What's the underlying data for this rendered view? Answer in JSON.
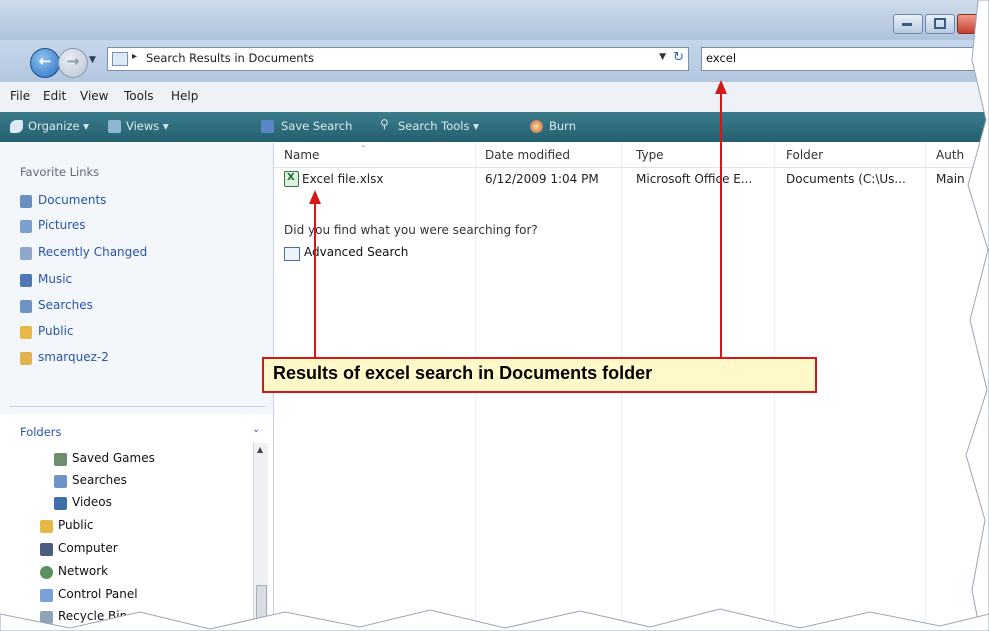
{
  "address_bar": {
    "path": "Search Results in Documents",
    "search_value": "excel"
  },
  "menu": [
    "File",
    "Edit",
    "View",
    "Tools",
    "Help"
  ],
  "toolbar": {
    "organize": "Organize ▾",
    "views": "Views ▾",
    "save_search": "Save Search",
    "search_tools": "Search Tools ▾",
    "burn": "Burn"
  },
  "nav_pane": {
    "favorite_links_title": "Favorite Links",
    "favorite_links": [
      "Documents",
      "Pictures",
      "Recently Changed",
      "Music",
      "Searches",
      "Public",
      "smarquez-2"
    ],
    "folders_title": "Folders",
    "folders": [
      "Saved Games",
      "Searches",
      "Videos",
      "Public",
      "Computer",
      "Network",
      "Control Panel",
      "Recycle Bin"
    ]
  },
  "columns": [
    "Name",
    "Date modified",
    "Type",
    "Folder",
    "Auth"
  ],
  "results": [
    {
      "name": "Excel file.xlsx",
      "date_modified": "6/12/2009 1:04 PM",
      "type": "Microsoft Office E...",
      "folder": "Documents (C:\\Us...",
      "author": "Main"
    }
  ],
  "help_text": "Did you find what you were searching for?",
  "advanced_search": "Advanced Search",
  "callout": "Results of excel search in Documents folder",
  "colors": {
    "accent": "#d11919",
    "callout_bg": "#fff8c8",
    "toolbar": "#2f6f7e",
    "link": "#2855a8"
  }
}
